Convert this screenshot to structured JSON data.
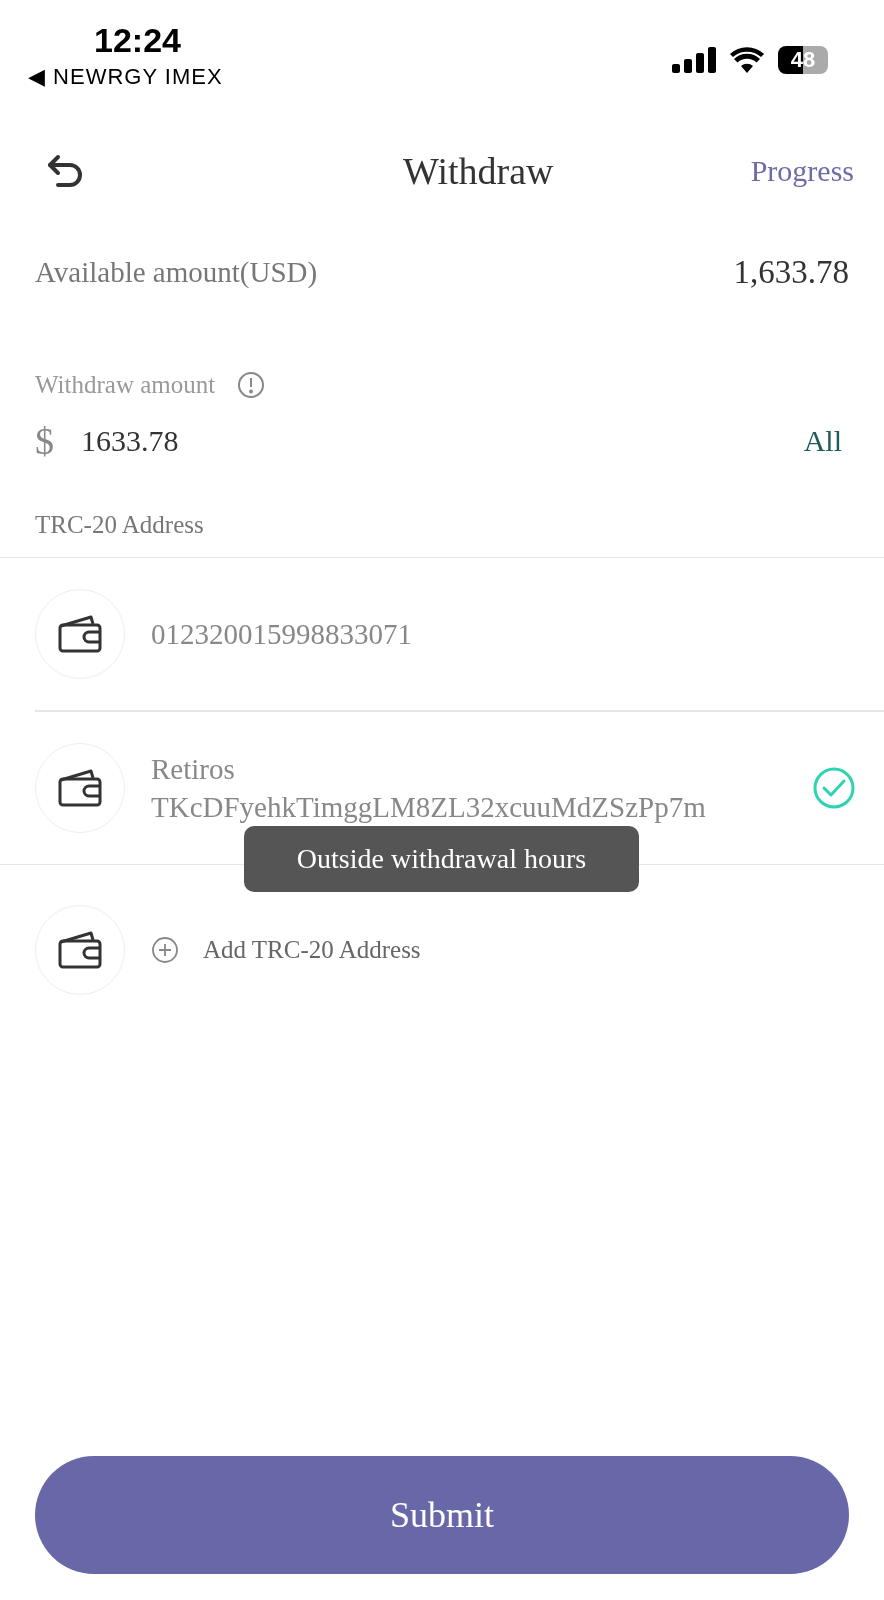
{
  "status_bar": {
    "time": "12:24",
    "back_app": "◀ NEWRGY IMEX",
    "battery": "48"
  },
  "header": {
    "title": "Withdraw",
    "action": "Progress"
  },
  "available": {
    "label": "Available amount(USD)",
    "value": "1,633.78"
  },
  "amount": {
    "label": "Withdraw amount",
    "currency": "$",
    "value": "1633.78",
    "all": "All"
  },
  "address_section": {
    "label": "TRC-20 Address"
  },
  "addresses": [
    {
      "address": "012320015998833071",
      "selected": false
    },
    {
      "name": "Retiros",
      "address": "TKcDFyehkTimggLM8ZL32xcuuMdZSzPp7m",
      "selected": true
    }
  ],
  "add_address": "Add TRC-20 Address",
  "toast": "Outside withdrawal hours",
  "submit": "Submit"
}
